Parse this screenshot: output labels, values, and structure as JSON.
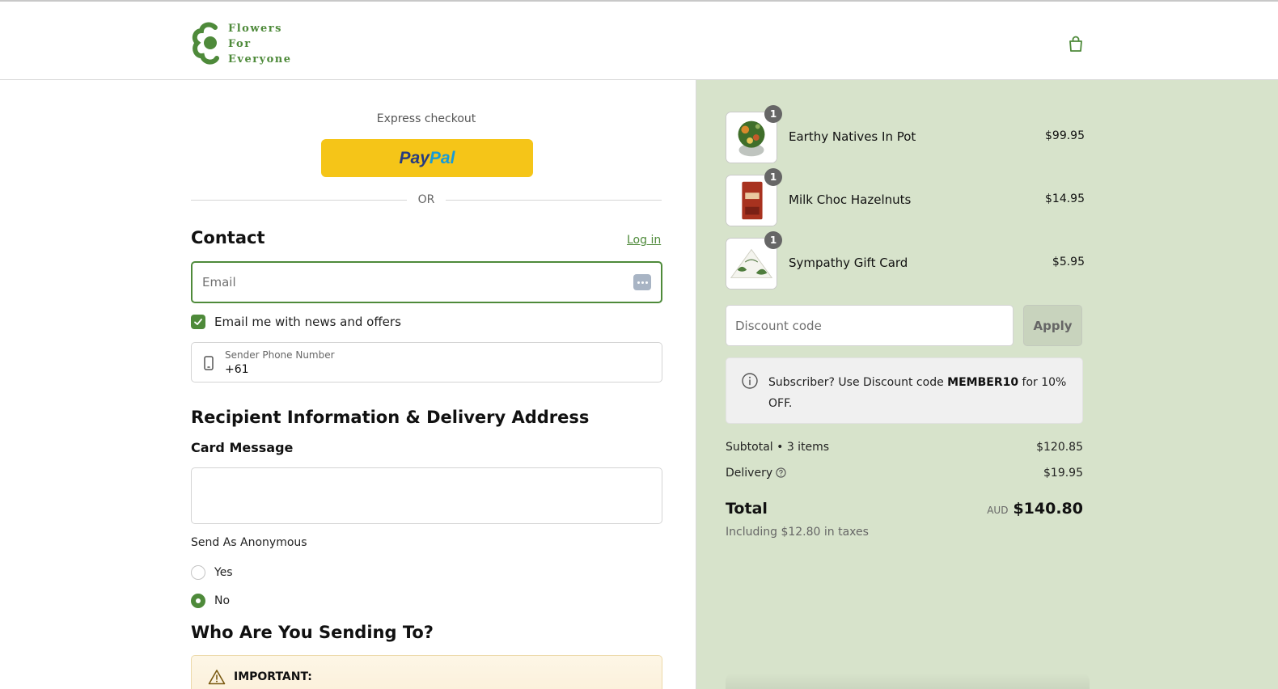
{
  "brand": {
    "line1": "Flowers",
    "line2": "For",
    "line3": "Everyone",
    "color": "#4e8a3a"
  },
  "header": {
    "cart_icon": "shopping-bag-icon"
  },
  "express": {
    "label": "Express checkout",
    "paypal_pay": "Pay",
    "paypal_pal": "Pal",
    "paypal_color": "#f5c518",
    "or_label": "OR"
  },
  "contact": {
    "title": "Contact",
    "login_label": "Log in",
    "email_placeholder": "Email",
    "news_label": "Email me with news and offers",
    "news_checked": true,
    "phone_label": "Sender Phone Number",
    "phone_value": "+61"
  },
  "recipient": {
    "title": "Recipient Information & Delivery Address",
    "card_message_label": "Card Message",
    "anonymous_label": "Send As Anonymous",
    "options": [
      "Yes",
      "No"
    ],
    "selected": "No"
  },
  "who": {
    "title": "Who Are You Sending To?",
    "important_label": "IMPORTANT:"
  },
  "cart": {
    "items": [
      {
        "name": "Earthy Natives In Pot",
        "price": "$99.95",
        "qty": "1"
      },
      {
        "name": "Milk Choc Hazelnuts",
        "price": "$14.95",
        "qty": "1"
      },
      {
        "name": "Sympathy Gift Card",
        "price": "$5.95",
        "qty": "1"
      }
    ],
    "discount_placeholder": "Discount code",
    "apply_label": "Apply",
    "promo_prefix": "Subscriber? Use Discount code ",
    "promo_code": "MEMBER10",
    "promo_suffix": " for 10% OFF.",
    "subtotal_label": "Subtotal • 3 items",
    "subtotal_value": "$120.85",
    "delivery_label": "Delivery",
    "delivery_value": "$19.95",
    "total_label": "Total",
    "currency": "AUD",
    "total_value": "$140.80",
    "taxes_note": "Including $12.80 in taxes",
    "panel_color": "#d7e3cb"
  }
}
